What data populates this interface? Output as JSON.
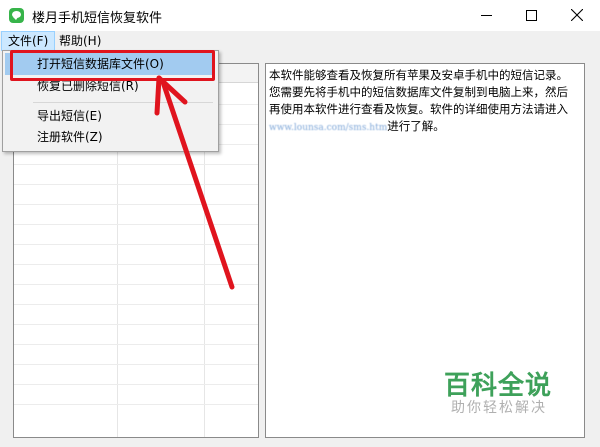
{
  "window": {
    "title": "楼月手机短信恢复软件",
    "icon": "chat-bubble-icon"
  },
  "menubar": {
    "file": "文件(F)",
    "help": "帮助(H)"
  },
  "file_menu": {
    "items": [
      {
        "label": "打开短信数据库文件(O)",
        "state": "highlighted"
      },
      {
        "label": "恢复已删除短信(R)"
      },
      {
        "label": "导出短信(E)"
      },
      {
        "label": "注册软件(Z)"
      }
    ]
  },
  "info_panel": {
    "line1": "本软件能够查看及恢复所有苹果及安卓手机中的短信记录。",
    "line2": "您需要先将手机中的短信数据库文件复制到电脑上来，然后",
    "line3": "再使用本软件进行查看及恢复。软件的详细使用方法请进入",
    "link": "www.lounsa.com/sms.htm",
    "line4_suffix": "进行了解。"
  },
  "watermark": {
    "logo": "百科全说",
    "sub": "助你轻松解决"
  },
  "colors": {
    "highlight_red": "#e0141e",
    "menu_highlight": "#a2cbf0",
    "app_icon": "#37b44a",
    "watermark_green": "#3ea15a"
  }
}
